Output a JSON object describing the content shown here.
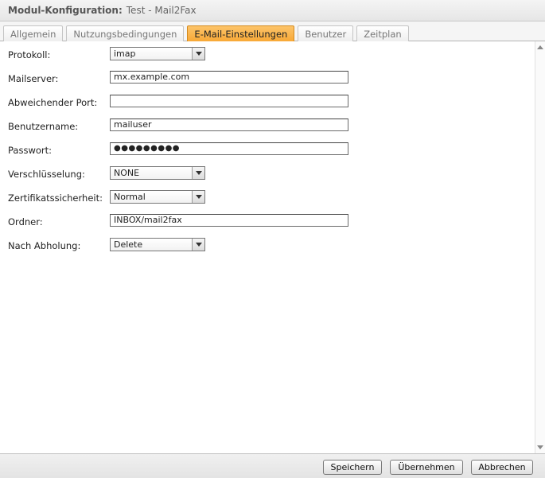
{
  "header": {
    "title": "Modul-Konfiguration:",
    "subtitle": "Test - Mail2Fax"
  },
  "tabs": [
    {
      "label": "Allgemein",
      "active": false
    },
    {
      "label": "Nutzungsbedingungen",
      "active": false
    },
    {
      "label": "E-Mail-Einstellungen",
      "active": true
    },
    {
      "label": "Benutzer",
      "active": false
    },
    {
      "label": "Zeitplan",
      "active": false
    }
  ],
  "form": {
    "protokoll": {
      "label": "Protokoll:",
      "value": "imap"
    },
    "mailserver": {
      "label": "Mailserver:",
      "value": "mx.example.com"
    },
    "port": {
      "label": "Abweichender Port:",
      "value": ""
    },
    "benutzername": {
      "label": "Benutzername:",
      "value": "mailuser"
    },
    "passwort": {
      "label": "Passwort:",
      "value": "●●●●●●●●●"
    },
    "verschluesselung": {
      "label": "Verschlüsselung:",
      "value": "NONE"
    },
    "zertifikat": {
      "label": "Zertifikatssicherheit:",
      "value": "Normal"
    },
    "ordner": {
      "label": "Ordner:",
      "value": "INBOX/mail2fax"
    },
    "abholung": {
      "label": "Nach Abholung:",
      "value": "Delete"
    }
  },
  "footer": {
    "save_label": "Speichern",
    "apply_label": "Übernehmen",
    "cancel_label": "Abbrechen"
  },
  "colors": {
    "active_tab": "#f8a733"
  }
}
